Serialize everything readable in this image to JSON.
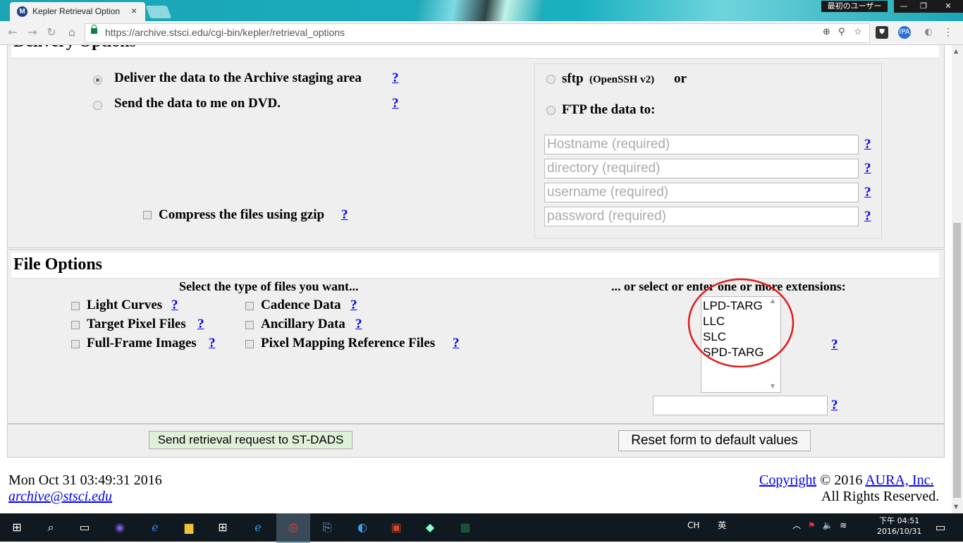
{
  "browser": {
    "tab_title": "Kepler Retrieval Option",
    "tab_close": "×",
    "favicon_letter": "M",
    "profile_name": "最初のユーザー",
    "url": "https://archive.stsci.edu/cgi-bin/kepler/retrieval_options",
    "window_controls": {
      "minimize": "—",
      "maximize": "❐",
      "close": "✕"
    },
    "nav_icons": {
      "back": "←",
      "forward": "→",
      "reload": "↻",
      "home": "⌂"
    },
    "omnibox_icons": {
      "zoom": "⊕",
      "pin": "⚲",
      "star": "☆"
    },
    "extensions": {
      "ext1": "⛊",
      "ext2": "IPA",
      "ext3": "◐",
      "menu": "⋮"
    }
  },
  "delivery": {
    "heading": "Delivery Options",
    "options": [
      {
        "label": "Deliver the data to the Archive staging area",
        "selected": true,
        "help": "?"
      },
      {
        "label": "Send the data to me on DVD.",
        "selected": false,
        "help": "?"
      }
    ],
    "compress_label": "Compress the files using gzip",
    "compress_help": "?",
    "sftp_label": "sftp",
    "sftp_sub": "(OpenSSH v2)",
    "or_label": "or",
    "ftp_label": "FTP the data to:",
    "fields": [
      {
        "placeholder": "Hostname (required)",
        "help": "?"
      },
      {
        "placeholder": "directory (required)",
        "help": "?"
      },
      {
        "placeholder": "username (required)",
        "help": "?"
      },
      {
        "placeholder": "password (required)",
        "help": "?"
      }
    ]
  },
  "file_options": {
    "heading": "File Options",
    "select_label": "Select the type of files you want...",
    "ext_label": "... or select or enter one or more extensions:",
    "col1": [
      {
        "label": "Light Curves",
        "help": "?"
      },
      {
        "label": "Target Pixel Files",
        "help": "?"
      },
      {
        "label": "Full-Frame Images",
        "help": "?"
      }
    ],
    "col2": [
      {
        "label": "Cadence Data",
        "help": "?"
      },
      {
        "label": "Ancillary Data",
        "help": "?"
      },
      {
        "label": "Pixel Mapping Reference Files",
        "help": "?"
      }
    ],
    "extensions": [
      "LPD-TARG",
      "LLC",
      "SLC",
      "SPD-TARG"
    ],
    "ext_help": "?",
    "ext_input_help": "?"
  },
  "actions": {
    "submit": "Send retrieval request to ST-DADS",
    "reset": "Reset form to default values"
  },
  "footer": {
    "date": "Mon Oct 31 03:49:31 2016",
    "email": "archive@stsci.edu",
    "copyright_link": "Copyright",
    "copyright_text": "© 2016",
    "aura_link": "AURA, Inc.",
    "rights": "All Rights Reserved."
  },
  "taskbar": {
    "tray_lang": "CH",
    "tray_ime": "英",
    "clock_time": "下午 04:51",
    "clock_date": "2016/10/31"
  },
  "colors": {
    "annotation_circle": "#e01b1b",
    "link": "#0000ee",
    "submit_bg": "#dff0d8"
  }
}
